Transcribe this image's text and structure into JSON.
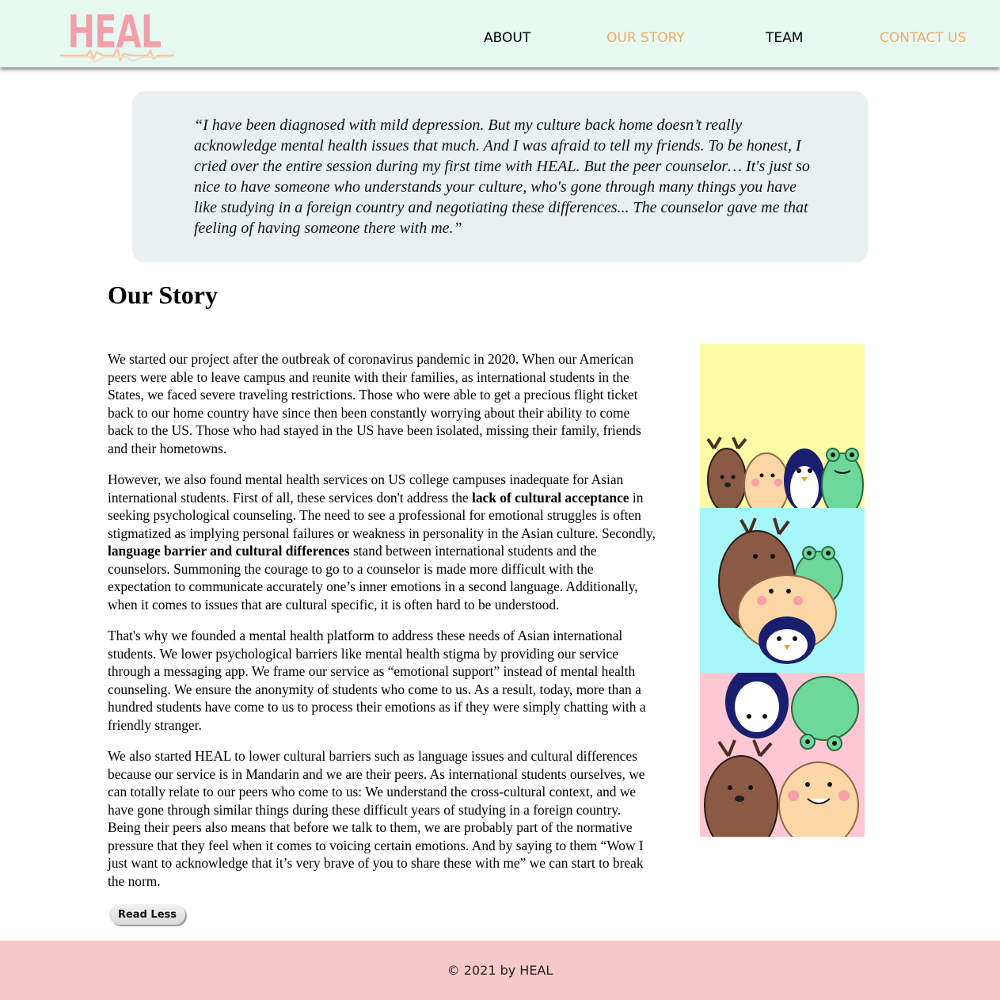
{
  "brand": {
    "logo_text": "HEAL"
  },
  "nav": {
    "items": [
      {
        "label": "ABOUT",
        "color": "#000000"
      },
      {
        "label": "OUR STORY",
        "color": "#f0a96b"
      },
      {
        "label": "TEAM",
        "color": "#000000"
      },
      {
        "label": "CONTACT US",
        "color": "#f0a96b"
      }
    ]
  },
  "quote": {
    "text": "“I have been diagnosed with mild depression. But my culture back home doesn’t really acknowledge mental health issues that much. And I was afraid to tell my friends. To be honest, I cried over the entire session during my first time with HEAL. But the peer counselor… It's just so nice to have someone who understands your culture, who's gone through many things you have like studying in a foreign country and negotiating these differences... The counselor gave me that feeling of having someone there with me.”"
  },
  "story": {
    "title": "Our Story",
    "p1": "We started our project after the outbreak of coronavirus pandemic in 2020. When our American peers were able to leave campus and reunite with their families, as international students in the States, we faced severe traveling restrictions. Those who were able to get a precious flight ticket back to our home country have since then been constantly worrying about their ability to come back to the US. Those who had stayed in the US have been isolated, missing their family, friends and their hometowns.",
    "p2_a": "However, we also found mental health services on US college campuses inadequate for Asian international students. First of all, these services don't address the ",
    "p2_b": "lack of cultural acceptance",
    "p2_c": " in seeking psychological counseling. The need to see a professional for emotional struggles is often stigmatized as implying personal failures or weakness in personality in the Asian culture. Secondly, ",
    "p2_d": "language barrier and cultural differences",
    "p2_e": " stand between international students and the counselors. Summoning the courage to go to a counselor is made more difficult with the expectation to communicate accurately one’s inner emotions in a second language. Additionally, when it comes to issues that are cultural specific, it is often hard to be understood.",
    "p3": "That's why we founded a mental health platform to address these needs of Asian international students. We lower psychological barriers like mental health stigma by providing our service through a messaging app. We frame our service as “emotional support” instead of mental health counseling. We ensure the anonymity of students who come to us. As a result, today, more than a hundred students have come to us to process their emotions as if they were simply chatting with a friendly stranger.",
    "p4": "We also started HEAL to lower cultural barriers such as language issues and cultural differences because our service is in Mandarin and we are their peers. As international students ourselves, we can totally relate to our peers who come to us: We understand the cross-cultural context, and we have gone through similar things during these difficult years of studying in a foreign country. Being their peers also means that before we talk to them, we are probably part of the normative pressure that they feel when it comes to voicing certain emotions. And by saying to them “Wow I just want to acknowledge that it’s very brave of you to share these with me” we can start to break the norm.",
    "read_less_label": "Read Less"
  },
  "artwork": {
    "panel_colors": [
      "#fbfba5",
      "#a6f7fa",
      "#fdc8d3"
    ],
    "characters": [
      "deer-character",
      "hamster-character",
      "penguin-character",
      "frog-character"
    ]
  },
  "footer": {
    "text": "© 2021 by HEAL"
  },
  "colors": {
    "header_bg": "#e6f9f1",
    "footer_bg": "#f6c8c9",
    "quote_bg": "#eaeff1",
    "logo_pink": "#f0a0a8",
    "accent": "#f0a96b"
  }
}
